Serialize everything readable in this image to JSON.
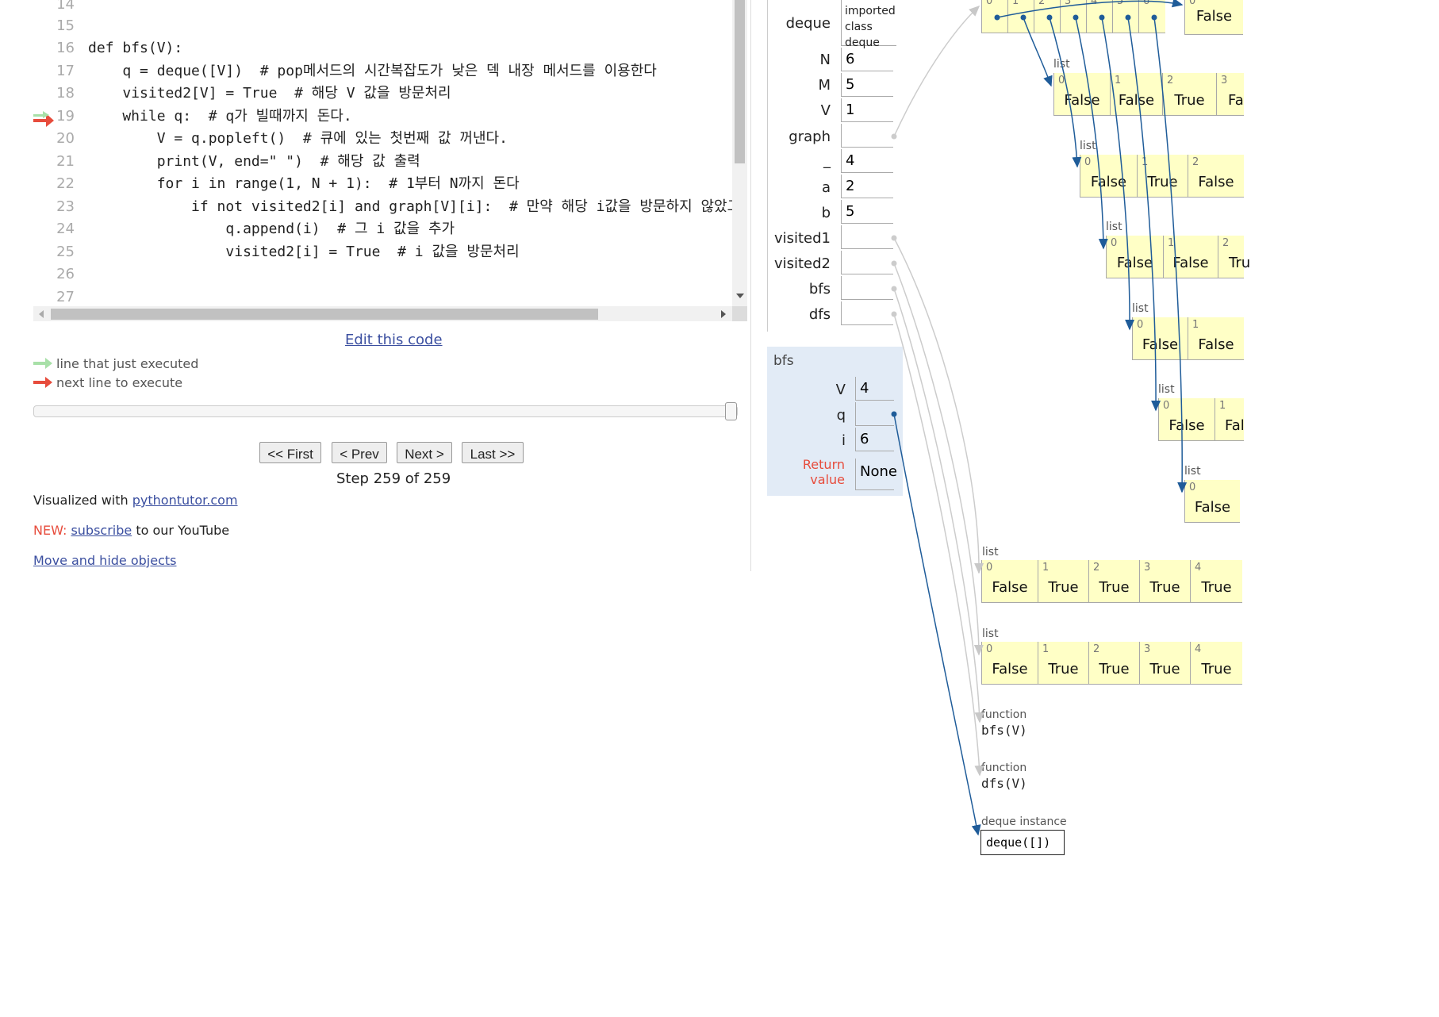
{
  "code": {
    "lines": [
      {
        "num": "14",
        "text": ""
      },
      {
        "num": "15",
        "text": ""
      },
      {
        "num": "16",
        "text": "def bfs(V):"
      },
      {
        "num": "17",
        "text": "    q = deque([V])  # pop메서드의 시간복잡도가 낮은 덱 내장 메서드를 이용한다"
      },
      {
        "num": "18",
        "text": "    visited2[V] = True  # 해당 V 값을 방문처리"
      },
      {
        "num": "19",
        "text": "    while q:  # q가 빌때까지 돈다."
      },
      {
        "num": "20",
        "text": "        V = q.popleft()  # 큐에 있는 첫번째 값 꺼낸다."
      },
      {
        "num": "21",
        "text": "        print(V, end=\" \")  # 해당 값 출력"
      },
      {
        "num": "22",
        "text": "        for i in range(1, N + 1):  # 1부터 N까지 돈다"
      },
      {
        "num": "23",
        "text": "            if not visited2[i] and graph[V][i]:  # 만약 해당 i값을 방문하지 않았고 V오"
      },
      {
        "num": "24",
        "text": "                q.append(i)  # 그 i 값을 추가"
      },
      {
        "num": "25",
        "text": "                visited2[i] = True  # i 값을 방문처리"
      },
      {
        "num": "26",
        "text": ""
      },
      {
        "num": "27",
        "text": ""
      }
    ]
  },
  "controls": {
    "edit_link": "Edit this code",
    "legend_executed": "line that just executed",
    "legend_next": "next line to execute",
    "first": "<< First",
    "prev": "< Prev",
    "next": "Next >",
    "last": "Last >>",
    "step": "Step 259 of 259"
  },
  "footer": {
    "visualized_prefix": "Visualized with ",
    "visualized_link": "pythontutor.com",
    "new_label": "NEW: ",
    "subscribe_link": "subscribe",
    "youtube_suffix": " to our YouTube",
    "move_hide_link": "Move and hide objects"
  },
  "globals": {
    "deque_name": "deque",
    "deque_value": [
      "imported",
      "class",
      "deque"
    ],
    "vars": [
      {
        "name": "N",
        "value": "6"
      },
      {
        "name": "M",
        "value": "5"
      },
      {
        "name": "V",
        "value": "1"
      },
      {
        "name": "graph",
        "value": ""
      },
      {
        "name": "_",
        "value": "4"
      },
      {
        "name": "a",
        "value": "2"
      },
      {
        "name": "b",
        "value": "5"
      },
      {
        "name": "visited1",
        "value": ""
      },
      {
        "name": "visited2",
        "value": ""
      },
      {
        "name": "bfs",
        "value": ""
      },
      {
        "name": "dfs",
        "value": ""
      }
    ]
  },
  "bfs_frame": {
    "title": "bfs",
    "vars": [
      {
        "name": "V",
        "value": "4"
      },
      {
        "name": "q",
        "value": ""
      },
      {
        "name": "i",
        "value": "6"
      }
    ],
    "return_label_1": "Return",
    "return_label_2": "value",
    "return_value": "None"
  },
  "heap": {
    "top_list_indices": [
      "0",
      "1",
      "2",
      "3",
      "4",
      "5",
      "6"
    ],
    "top_right_index": "0",
    "top_right_value": "False",
    "rows": [
      {
        "label": "list",
        "cells": [
          {
            "i": "0",
            "v": "False"
          },
          {
            "i": "1",
            "v": "False"
          },
          {
            "i": "2",
            "v": "True"
          },
          {
            "i": "3",
            "v": "Fa"
          }
        ]
      },
      {
        "label": "list",
        "cells": [
          {
            "i": "0",
            "v": "False"
          },
          {
            "i": "1",
            "v": "True"
          },
          {
            "i": "2",
            "v": "False"
          }
        ]
      },
      {
        "label": "list",
        "cells": [
          {
            "i": "0",
            "v": "False"
          },
          {
            "i": "1",
            "v": "False"
          },
          {
            "i": "2",
            "v": "Tru"
          }
        ]
      },
      {
        "label": "list",
        "cells": [
          {
            "i": "0",
            "v": "False"
          },
          {
            "i": "1",
            "v": "False"
          }
        ]
      },
      {
        "label": "list",
        "cells": [
          {
            "i": "0",
            "v": "False"
          },
          {
            "i": "1",
            "v": "Fal"
          }
        ]
      },
      {
        "label": "list",
        "cells": [
          {
            "i": "0",
            "v": "False"
          }
        ]
      }
    ],
    "visited_lists": [
      {
        "label": "list",
        "cells": [
          {
            "i": "0",
            "v": "False"
          },
          {
            "i": "1",
            "v": "True"
          },
          {
            "i": "2",
            "v": "True"
          },
          {
            "i": "3",
            "v": "True"
          },
          {
            "i": "4",
            "v": "True"
          }
        ]
      },
      {
        "label": "list",
        "cells": [
          {
            "i": "0",
            "v": "False"
          },
          {
            "i": "1",
            "v": "True"
          },
          {
            "i": "2",
            "v": "True"
          },
          {
            "i": "3",
            "v": "True"
          },
          {
            "i": "4",
            "v": "True"
          }
        ]
      }
    ],
    "func_bfs_label": "function",
    "func_bfs_sig": "bfs(V)",
    "func_dfs_label": "function",
    "func_dfs_sig": "dfs(V)",
    "deque_inst_label": "deque instance",
    "deque_inst_value": "deque([])"
  },
  "colors": {
    "arrow_blue": "#1f5c99",
    "arrow_grey": "#cccccc",
    "next_arrow_red": "#e74c3c",
    "executed_arrow_green": "#a8e0a8",
    "heap_yellow": "#ffffc6",
    "frame_blue": "#e2ebf6"
  }
}
